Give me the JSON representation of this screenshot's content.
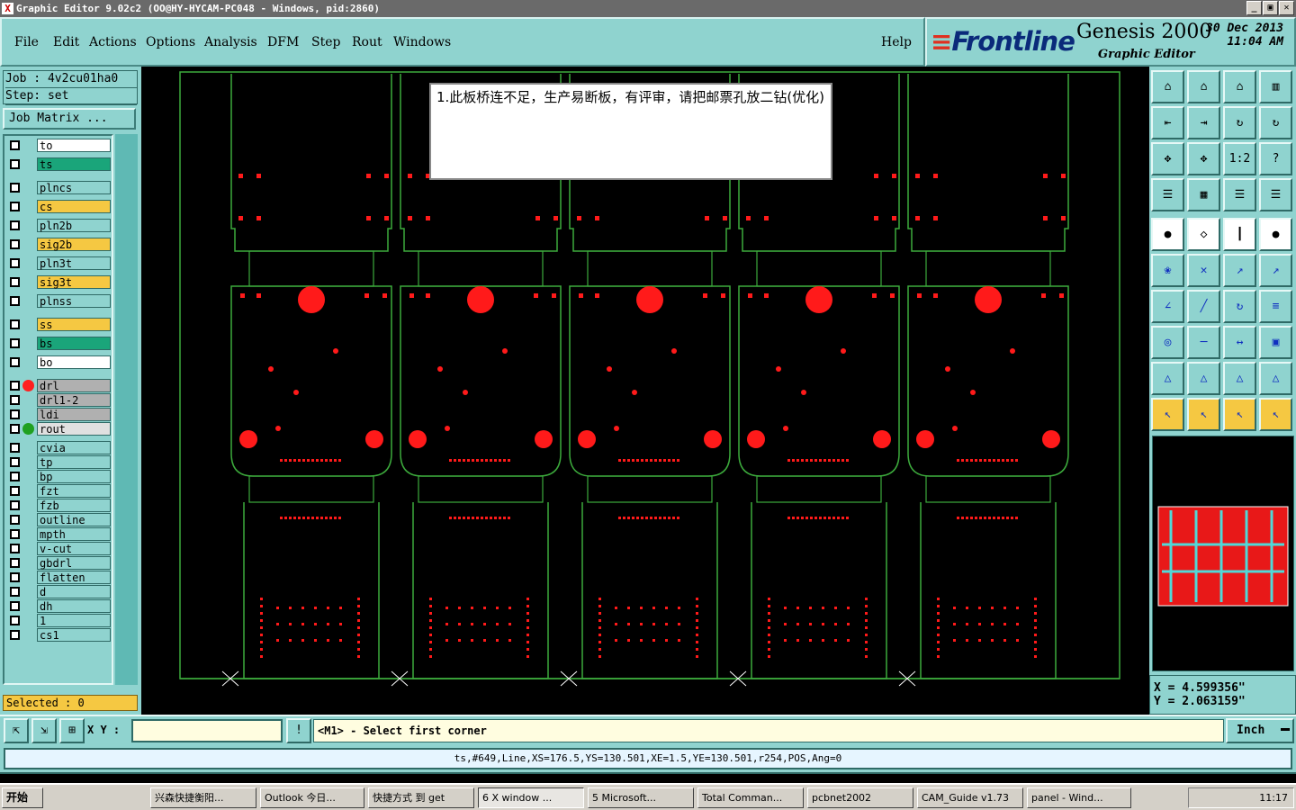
{
  "window": {
    "title": "Graphic Editor 9.02c2 (OO@HY-HYCAM-PC048 - Windows, pid:2860)",
    "app_icon": "X"
  },
  "menu": [
    "File",
    "Edit",
    "Actions",
    "Options",
    "Analysis",
    "DFM",
    "Step",
    "Rout",
    "Windows"
  ],
  "help": "Help",
  "logo": {
    "brand_prefix": "≡",
    "brand": "Frontline",
    "product": "Genesis 2000",
    "subtitle": "Graphic Editor",
    "date": "30 Dec 2013",
    "time": "11:04 AM"
  },
  "job": {
    "job_line": "Job : 4v2cu01ha0",
    "step_line": "Step: set",
    "matrix_button": "Job Matrix ..."
  },
  "layers": [
    {
      "name": "to",
      "color": "#ffffff"
    },
    {
      "name": "ts",
      "color": "#1aa57a"
    },
    {
      "name": "plncs",
      "color": "#8fd3cf"
    },
    {
      "name": "cs",
      "color": "#f5c842"
    },
    {
      "name": "pln2b",
      "color": "#8fd3cf"
    },
    {
      "name": "sig2b",
      "color": "#f5c842"
    },
    {
      "name": "pln3t",
      "color": "#8fd3cf"
    },
    {
      "name": "sig3t",
      "color": "#f5c842"
    },
    {
      "name": "plnss",
      "color": "#8fd3cf"
    },
    {
      "name": "ss",
      "color": "#f5c842"
    },
    {
      "name": "bs",
      "color": "#1aa57a"
    },
    {
      "name": "bo",
      "color": "#ffffff"
    },
    {
      "name": "drl",
      "color": "#b0b0b0",
      "dot": "#ff2020",
      "active": true
    },
    {
      "name": "drl1-2",
      "color": "#b0b0b0"
    },
    {
      "name": "ldi",
      "color": "#b0b0b0"
    },
    {
      "name": "rout",
      "color": "#e0e0e0",
      "dot": "#20a020"
    },
    {
      "name": "cvia",
      "color": "#8fd3cf"
    },
    {
      "name": "tp",
      "color": "#8fd3cf"
    },
    {
      "name": "bp",
      "color": "#8fd3cf"
    },
    {
      "name": "fzt",
      "color": "#8fd3cf"
    },
    {
      "name": "fzb",
      "color": "#8fd3cf"
    },
    {
      "name": "outline",
      "color": "#8fd3cf"
    },
    {
      "name": "mpth",
      "color": "#8fd3cf"
    },
    {
      "name": "v-cut",
      "color": "#8fd3cf"
    },
    {
      "name": "gbdrl",
      "color": "#8fd3cf"
    },
    {
      "name": "flatten",
      "color": "#8fd3cf"
    },
    {
      "name": "d",
      "color": "#8fd3cf"
    },
    {
      "name": "dh",
      "color": "#8fd3cf"
    },
    {
      "name": "1",
      "color": "#8fd3cf"
    },
    {
      "name": "cs1",
      "color": "#8fd3cf"
    }
  ],
  "selected": "Selected : 0",
  "note": "1.此板桥连不足，生产易断板，有评审，请把邮票孔放二钻(优化)",
  "coords": {
    "x": "X = 4.599356\"",
    "y": "Y = 2.063159\""
  },
  "command": {
    "xy_label": "X Y :",
    "xy_value": "",
    "bang": "!",
    "prompt": "<M1> - Select first corner",
    "unit": "Inch"
  },
  "info": "ts,#649,Line,XS=176.5,YS=130.501,XE=1.5,YE=130.501,r254,POS,Ang=0",
  "taskbar": {
    "start": "开始",
    "tasks": [
      "兴森快捷衡阳...",
      "Outlook 今日...",
      "快捷方式 到 get",
      "6 X window ...",
      "5 Microsoft...",
      "Total Comman...",
      "pcbnet2002",
      "CAM_Guide v1.73",
      "panel - Wind..."
    ],
    "clock": "11:17"
  },
  "colors": {
    "panel": "#8fd3cf",
    "outline": "#3caa3c",
    "pad": "#ff1a1a",
    "canvas": "#000000"
  }
}
